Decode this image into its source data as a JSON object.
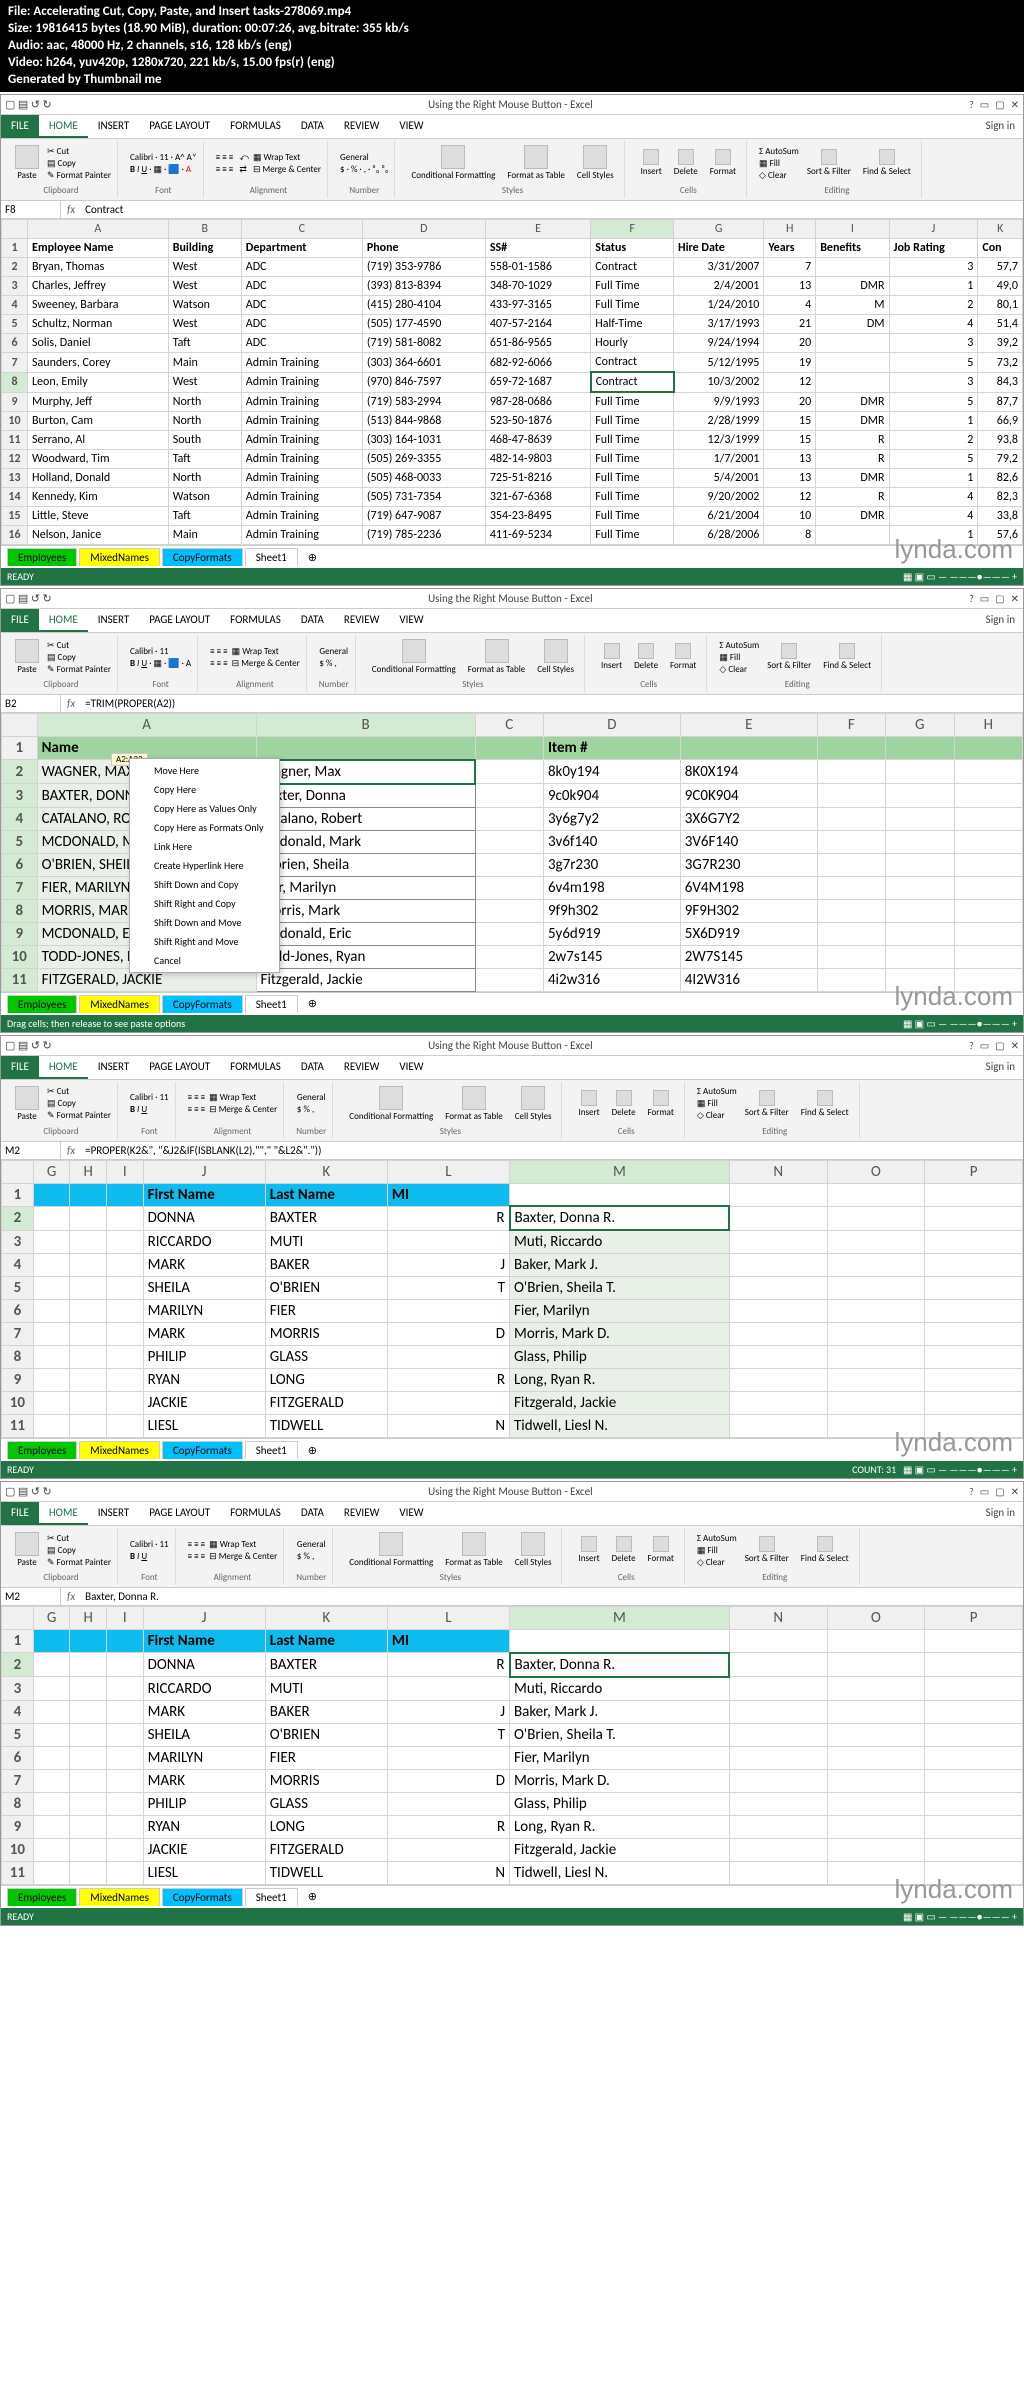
{
  "meta_header": {
    "l1": "File: Accelerating Cut, Copy, Paste, and Insert tasks-278069.mp4",
    "l2": "Size: 19816415 bytes (18.90 MiB), duration: 00:07:26, avg.bitrate: 355 kb/s",
    "l3": "Audio: aac, 48000 Hz, 2 channels, s16, 128 kb/s (eng)",
    "l4": "Video: h264, yuv420p, 1280x720, 221 kb/s, 15.00 fps(r) (eng)",
    "l5": "Generated by Thumbnail me"
  },
  "window_title": "Using the Right Mouse Button - Excel",
  "signin": "Sign in",
  "tabs": [
    "FILE",
    "HOME",
    "INSERT",
    "PAGE LAYOUT",
    "FORMULAS",
    "DATA",
    "REVIEW",
    "VIEW"
  ],
  "ribbon": {
    "clipboard": {
      "cut": "Cut",
      "copy": "Copy",
      "fp": "Format Painter",
      "paste": "Paste",
      "label": "Clipboard"
    },
    "font": {
      "name": "Calibri",
      "size": "11",
      "label": "Font"
    },
    "align": {
      "wrap": "Wrap Text",
      "merge": "Merge & Center",
      "label": "Alignment"
    },
    "number": {
      "fmt": "General",
      "label": "Number"
    },
    "styles": {
      "cf": "Conditional Formatting",
      "ft": "Format as Table",
      "cs": "Cell Styles",
      "label": "Styles"
    },
    "cells": {
      "ins": "Insert",
      "del": "Delete",
      "fmt": "Format",
      "label": "Cells"
    },
    "editing": {
      "sum": "AutoSum",
      "fill": "Fill",
      "clear": "Clear",
      "sort": "Sort & Filter",
      "find": "Find & Select",
      "label": "Editing"
    }
  },
  "panel1": {
    "namebox": "F8",
    "formula": "Contract",
    "cols": [
      "A",
      "B",
      "C",
      "D",
      "E",
      "F",
      "G",
      "H",
      "I",
      "J",
      "K"
    ],
    "headers": [
      "Employee Name",
      "Building",
      "Department",
      "Phone",
      "SS#",
      "Status",
      "Hire Date",
      "Years",
      "Benefits",
      "Job Rating",
      "Con"
    ],
    "rows": [
      [
        "Bryan, Thomas",
        "West",
        "ADC",
        "(719) 353-9786",
        "558-01-1586",
        "Contract",
        "3/31/2007",
        "7",
        "",
        "3",
        "57,7"
      ],
      [
        "Charles, Jeffrey",
        "West",
        "ADC",
        "(393) 813-8394",
        "348-70-1029",
        "Full Time",
        "2/4/2001",
        "13",
        "DMR",
        "1",
        "49,0"
      ],
      [
        "Sweeney, Barbara",
        "Watson",
        "ADC",
        "(415) 280-4104",
        "433-97-3165",
        "Full Time",
        "1/24/2010",
        "4",
        "M",
        "2",
        "80,1"
      ],
      [
        "Schultz, Norman",
        "West",
        "ADC",
        "(505) 177-4590",
        "407-57-2164",
        "Half-Time",
        "3/17/1993",
        "21",
        "DM",
        "4",
        "51,4"
      ],
      [
        "Solis, Daniel",
        "Taft",
        "ADC",
        "(719) 581-8082",
        "651-86-9565",
        "Hourly",
        "9/24/1994",
        "20",
        "",
        "3",
        "39,2"
      ],
      [
        "Saunders, Corey",
        "Main",
        "Admin Training",
        "(303) 364-6601",
        "682-92-6066",
        "Contract",
        "5/12/1995",
        "19",
        "",
        "5",
        "73,2"
      ],
      [
        "Leon, Emily",
        "West",
        "Admin Training",
        "(970) 846-7597",
        "659-72-1687",
        "Contract",
        "10/3/2002",
        "12",
        "",
        "3",
        "84,3"
      ],
      [
        "Murphy, Jeff",
        "North",
        "Admin Training",
        "(719) 583-2994",
        "987-28-0686",
        "Full Time",
        "9/9/1993",
        "20",
        "DMR",
        "5",
        "87,7"
      ],
      [
        "Burton, Cam",
        "North",
        "Admin Training",
        "(513) 844-9868",
        "523-50-1876",
        "Full Time",
        "2/28/1999",
        "15",
        "DMR",
        "1",
        "66,9"
      ],
      [
        "Serrano, Al",
        "South",
        "Admin Training",
        "(303) 164-1031",
        "468-47-8639",
        "Full Time",
        "12/3/1999",
        "15",
        "R",
        "2",
        "93,8"
      ],
      [
        "Woodward, Tim",
        "Taft",
        "Admin Training",
        "(505) 269-3355",
        "482-14-9803",
        "Full Time",
        "1/7/2001",
        "13",
        "R",
        "5",
        "79,2"
      ],
      [
        "Holland, Donald",
        "North",
        "Admin Training",
        "(505) 468-0033",
        "725-51-8216",
        "Full Time",
        "5/4/2001",
        "13",
        "DMR",
        "1",
        "82,6"
      ],
      [
        "Kennedy, Kim",
        "Watson",
        "Admin Training",
        "(505) 731-7354",
        "321-67-6368",
        "Full Time",
        "9/20/2002",
        "12",
        "R",
        "4",
        "82,3"
      ],
      [
        "Little, Steve",
        "Taft",
        "Admin Training",
        "(719) 647-9087",
        "354-23-8495",
        "Full Time",
        "6/21/2004",
        "10",
        "DMR",
        "4",
        "33,8"
      ],
      [
        "Nelson, Janice",
        "Main",
        "Admin Training",
        "(719) 785-2236",
        "411-69-5234",
        "Full Time",
        "6/28/2006",
        "8",
        "",
        "1",
        "57,6"
      ]
    ],
    "sheets": [
      "Employees",
      "MixedNames",
      "CopyFormats",
      "Sheet1"
    ],
    "status": "READY"
  },
  "panel2": {
    "namebox": "B2",
    "formula": "=TRIM(PROPER(A2))",
    "range_label": "A2:A32",
    "cols": [
      "A",
      "B",
      "C",
      "D",
      "E",
      "F",
      "G",
      "H"
    ],
    "h_name": "Name",
    "h_item": "Item #",
    "rows": [
      [
        "WAGNER, MAX",
        "Wagner, Max",
        "",
        "8k0y194",
        "8K0X194"
      ],
      [
        "BAXTER, DONNA",
        "Baxter, Donna",
        "",
        "9c0k904",
        "9C0K904"
      ],
      [
        "CATALANO, ROBERT",
        "Catalano, Robert",
        "",
        "3y6g7y2",
        "3X6G7Y2"
      ],
      [
        "MCDONALD, MARK",
        "Mcdonald, Mark",
        "",
        "3v6f140",
        "3V6F140"
      ],
      [
        "O'BRIEN, SHEILA",
        "O'brien, Sheila",
        "",
        "3g7r230",
        "3G7R230"
      ],
      [
        "FIER, MARILYN",
        "Fier, Marilyn",
        "",
        "6v4m198",
        "6V4M198"
      ],
      [
        "MORRIS, MARK",
        "Morris, Mark",
        "",
        "9f9h302",
        "9F9H302"
      ],
      [
        "MCDONALD, ERIC",
        "Mcdonald, Eric",
        "",
        "5y6d919",
        "5X6D919"
      ],
      [
        "TODD-JONES, RYAN",
        "Todd-Jones, Ryan",
        "",
        "2w7s145",
        "2W7S145"
      ],
      [
        "FITZGERALD, JACKIE",
        "Fitzgerald, Jackie",
        "",
        "4i2w316",
        "4I2W316"
      ]
    ],
    "ctx": [
      "Move Here",
      "Copy Here",
      "Copy Here as Values Only",
      "Copy Here as Formats Only",
      "Link Here",
      "Create Hyperlink Here",
      "Shift Down and Copy",
      "Shift Right and Copy",
      "Shift Down and Move",
      "Shift Right and Move",
      "Cancel"
    ],
    "sheets": [
      "Employees",
      "MixedNames",
      "CopyFormats",
      "Sheet1"
    ],
    "status": "Drag cells; then release to see paste options"
  },
  "panel3": {
    "namebox": "M2",
    "formula": "=PROPER(K2&\", \"&J2&IF(ISBLANK(L2),\"\",\" \"&L2&\".\"))",
    "cols": [
      "G",
      "H",
      "I",
      "J",
      "K",
      "L",
      "M",
      "N",
      "O",
      "P"
    ],
    "headers": [
      "First Name",
      "Last Name",
      "MI"
    ],
    "rows": [
      [
        "DONNA",
        "BAXTER",
        "R",
        "Baxter, Donna R."
      ],
      [
        "RICCARDO",
        "MUTI",
        "",
        "Muti, Riccardo"
      ],
      [
        "MARK",
        "BAKER",
        "J",
        "Baker, Mark J."
      ],
      [
        "SHEILA",
        "O'BRIEN",
        "T",
        "O'Brien, Sheila T."
      ],
      [
        "MARILYN",
        "FIER",
        "",
        "Fier, Marilyn"
      ],
      [
        "MARK",
        "MORRIS",
        "D",
        "Morris, Mark D."
      ],
      [
        "PHILIP",
        "GLASS",
        "",
        "Glass, Philip"
      ],
      [
        "RYAN",
        "LONG",
        "R",
        "Long, Ryan R."
      ],
      [
        "JACKIE",
        "FITZGERALD",
        "",
        "Fitzgerald, Jackie"
      ],
      [
        "LIESL",
        "TIDWELL",
        "N",
        "Tidwell, Liesl N."
      ]
    ],
    "sheets": [
      "Employees",
      "MixedNames",
      "CopyFormats",
      "Sheet1"
    ],
    "status": "READY",
    "count": "COUNT: 31"
  },
  "panel4": {
    "namebox": "M2",
    "formula": "Baxter, Donna R.",
    "cols": [
      "G",
      "H",
      "I",
      "J",
      "K",
      "L",
      "M",
      "N",
      "O",
      "P"
    ],
    "headers": [
      "First Name",
      "Last Name",
      "MI"
    ],
    "rows": [
      [
        "DONNA",
        "BAXTER",
        "R",
        "Baxter, Donna R."
      ],
      [
        "RICCARDO",
        "MUTI",
        "",
        "Muti, Riccardo"
      ],
      [
        "MARK",
        "BAKER",
        "J",
        "Baker, Mark J."
      ],
      [
        "SHEILA",
        "O'BRIEN",
        "T",
        "O'Brien, Sheila T."
      ],
      [
        "MARILYN",
        "FIER",
        "",
        "Fier, Marilyn"
      ],
      [
        "MARK",
        "MORRIS",
        "D",
        "Morris, Mark D."
      ],
      [
        "PHILIP",
        "GLASS",
        "",
        "Glass, Philip"
      ],
      [
        "RYAN",
        "LONG",
        "R",
        "Long, Ryan R."
      ],
      [
        "JACKIE",
        "FITZGERALD",
        "",
        "Fitzgerald, Jackie"
      ],
      [
        "LIESL",
        "TIDWELL",
        "N",
        "Tidwell, Liesl N."
      ]
    ],
    "sheets": [
      "Employees",
      "MixedNames",
      "CopyFormats",
      "Sheet1"
    ],
    "status": "READY"
  }
}
